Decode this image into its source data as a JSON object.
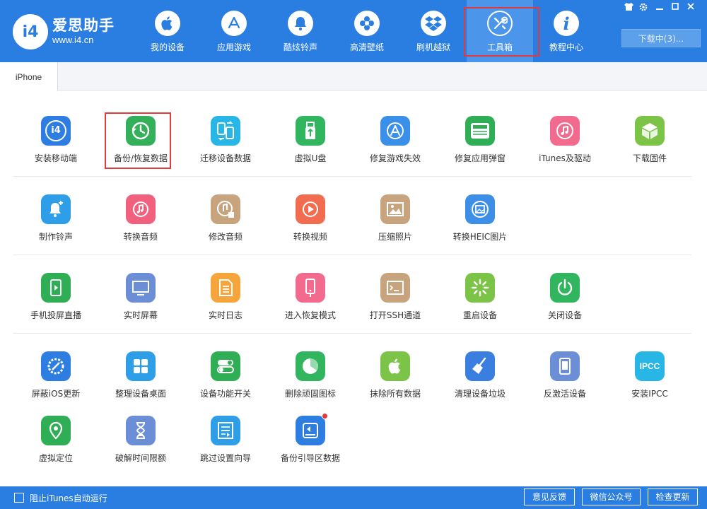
{
  "app": {
    "logo_mark": "i4",
    "name": "爱思助手",
    "url": "www.i4.cn"
  },
  "nav": [
    {
      "label": "我的设备",
      "icon": "apple-icon"
    },
    {
      "label": "应用游戏",
      "icon": "app-store-icon"
    },
    {
      "label": "酷炫铃声",
      "icon": "bell-icon"
    },
    {
      "label": "高清壁纸",
      "icon": "flower-icon"
    },
    {
      "label": "刷机越狱",
      "icon": "dropbox-icon"
    },
    {
      "label": "工具箱",
      "icon": "tools-icon",
      "active": true
    },
    {
      "label": "教程中心",
      "icon": "info-icon"
    }
  ],
  "window_controls": [
    "shirt-icon",
    "gear-icon",
    "minimize-icon",
    "maximize-icon",
    "close-icon"
  ],
  "download_button": "下载中(3)...",
  "tabs": [
    {
      "label": "iPhone"
    }
  ],
  "tools": {
    "row1": [
      {
        "label": "安装移动端",
        "icon": "i4-icon",
        "color": "#2e7de0"
      },
      {
        "label": "备份/恢复数据",
        "icon": "backup-clock-icon",
        "color": "#35b05a"
      },
      {
        "label": "迁移设备数据",
        "icon": "phone-transfer-icon",
        "color": "#27b6e6"
      },
      {
        "label": "虚拟U盘",
        "icon": "usb-icon",
        "color": "#31b55f"
      },
      {
        "label": "修复游戏失效",
        "icon": "app-store-repair-icon",
        "color": "#3a8fe8"
      },
      {
        "label": "修复应用弹窗",
        "icon": "apple-id-icon",
        "color": "#2fae55"
      },
      {
        "label": "iTunes及驱动",
        "icon": "itunes-icon",
        "color": "#f26a8d"
      },
      {
        "label": "下载固件",
        "icon": "cube-icon",
        "color": "#7cc447"
      }
    ],
    "row2": [
      {
        "label": "制作铃声",
        "icon": "bell-plus-icon",
        "color": "#2e9ee8"
      },
      {
        "label": "转换音频",
        "icon": "music-convert-icon",
        "color": "#f1617e"
      },
      {
        "label": "修改音频",
        "icon": "music-edit-icon",
        "color": "#c8a47e"
      },
      {
        "label": "转换视频",
        "icon": "video-convert-icon",
        "color": "#f26c4f"
      },
      {
        "label": "压缩照片",
        "icon": "photo-icon",
        "color": "#c8a47e"
      },
      {
        "label": "转换HEIC图片",
        "icon": "heic-icon",
        "color": "#3d8ee6"
      }
    ],
    "row3": [
      {
        "label": "手机投屏直播",
        "icon": "screen-cast-icon",
        "color": "#2fae55"
      },
      {
        "label": "实时屏幕",
        "icon": "monitor-icon",
        "color": "#6b8ed6"
      },
      {
        "label": "实时日志",
        "icon": "log-icon",
        "color": "#f5a53c"
      },
      {
        "label": "进入恢复模式",
        "icon": "recovery-phone-icon",
        "color": "#f26a8d"
      },
      {
        "label": "打开SSH通道",
        "icon": "terminal-icon",
        "color": "#c8a47e"
      },
      {
        "label": "重启设备",
        "icon": "restart-icon",
        "color": "#7cc447"
      },
      {
        "label": "关闭设备",
        "icon": "power-icon",
        "color": "#31b55f"
      }
    ],
    "row4": [
      {
        "label": "屏蔽iOS更新",
        "icon": "block-update-icon",
        "color": "#2e7de0"
      },
      {
        "label": "整理设备桌面",
        "icon": "grid-icon",
        "color": "#2e9ee8"
      },
      {
        "label": "设备功能开关",
        "icon": "toggle-icon",
        "color": "#2fae55"
      },
      {
        "label": "删除顽固图标",
        "icon": "pie-icon",
        "color": "#31b55f"
      },
      {
        "label": "抹除所有数据",
        "icon": "apple-erase-icon",
        "color": "#7cc447"
      },
      {
        "label": "清理设备垃圾",
        "icon": "broom-icon",
        "color": "#3a7fe0"
      },
      {
        "label": "反激活设备",
        "icon": "deactivate-icon",
        "color": "#6b8ed6"
      },
      {
        "label": "安装IPCC",
        "icon": "ipcc-icon",
        "color": "#27b6e6",
        "text": "IPCC"
      }
    ],
    "row5": [
      {
        "label": "虚拟定位",
        "icon": "location-icon",
        "color": "#2fae55"
      },
      {
        "label": "破解时间限额",
        "icon": "hourglass-icon",
        "color": "#6b8ed6"
      },
      {
        "label": "跳过设置向导",
        "icon": "skip-wizard-icon",
        "color": "#2e9ee8"
      },
      {
        "label": "备份引导区数据",
        "icon": "disk-backup-icon",
        "color": "#2e7de0",
        "badge": true
      }
    ]
  },
  "footer": {
    "checkbox_label": "阻止iTunes自动运行",
    "buttons": [
      "意见反馈",
      "微信公众号",
      "检查更新"
    ]
  },
  "colors": {
    "primary": "#2a7de1",
    "highlight": "#e33b3b"
  }
}
